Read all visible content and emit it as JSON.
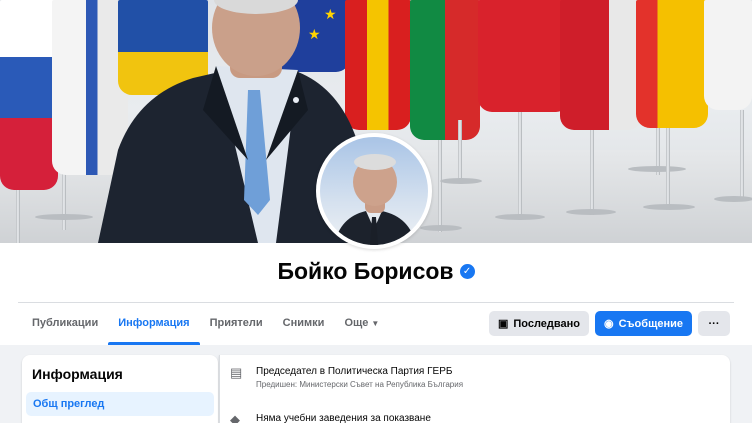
{
  "profile": {
    "name": "Бойко Борисов",
    "verified_icon": "verified-badge-icon"
  },
  "tabs": [
    {
      "label": "Публикации",
      "active": false
    },
    {
      "label": "Информация",
      "active": true
    },
    {
      "label": "Приятели",
      "active": false
    },
    {
      "label": "Снимки",
      "active": false
    },
    {
      "label": "Още",
      "active": false
    }
  ],
  "actions": {
    "following_label": "Последвано",
    "message_label": "Съобщение",
    "more_label": "···"
  },
  "about": {
    "title": "Информация",
    "overview_label": "Общ преглед"
  },
  "info": {
    "work_main": "Председател в Политическа Партия ГЕРБ",
    "work_sub": "Предишен: Министерски Съвет на Република България",
    "education_main": "Няма учебни заведения за показване"
  },
  "colors": {
    "accent": "#1877f2",
    "background": "#f0f2f5",
    "tab_inactive": "#65676b"
  }
}
